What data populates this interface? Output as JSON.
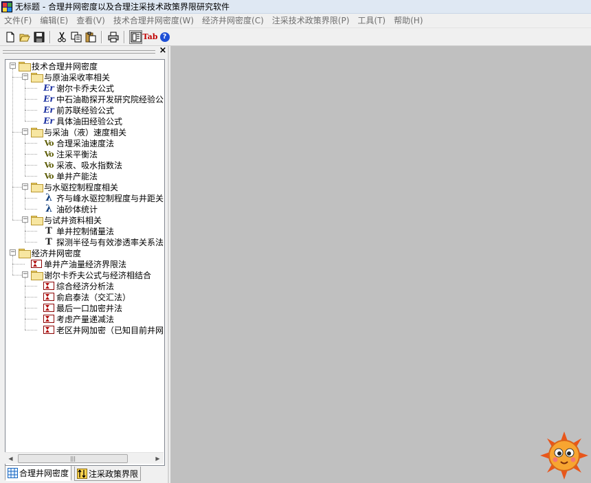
{
  "window": {
    "title": "无标题 - 合理井网密度以及合理注采技术政策界限研究软件"
  },
  "menu": [
    "文件(F)",
    "编辑(E)",
    "查看(V)",
    "技术合理井网密度(W)",
    "经济井网密度(C)",
    "注采技术政策界限(P)",
    "工具(T)",
    "帮助(H)"
  ],
  "toolbar": {
    "buttons": [
      "new-file-icon",
      "open-folder-icon",
      "save-disk-icon",
      "cut-scissors-icon",
      "copy-icon",
      "paste-icon",
      "print-icon",
      "tree-view-icon",
      "tab-icon",
      "help-icon"
    ],
    "tab_label": "Tab",
    "help_label": "?"
  },
  "tree": {
    "nodes": [
      {
        "label": "技术合理井网密度",
        "icon": "folder",
        "level": 0
      },
      {
        "label": "与原油采收率相关",
        "icon": "folder",
        "level": 1
      },
      {
        "label": "谢尔卡乔夫公式",
        "icon": "er",
        "level": 2
      },
      {
        "label": "中石油勘探开发研究院经验公",
        "icon": "er",
        "level": 2
      },
      {
        "label": "前苏联经验公式",
        "icon": "er",
        "level": 2
      },
      {
        "label": "具体油田经验公式",
        "icon": "er",
        "level": 2
      },
      {
        "label": "与采油（液）速度相关",
        "icon": "folder",
        "level": 1
      },
      {
        "label": "合理采油速度法",
        "icon": "vo",
        "level": 2
      },
      {
        "label": "注采平衡法",
        "icon": "vo",
        "level": 2
      },
      {
        "label": "采液、吸水指数法",
        "icon": "vo",
        "level": 2
      },
      {
        "label": "单井产能法",
        "icon": "vo",
        "level": 2
      },
      {
        "label": "与水驱控制程度相关",
        "icon": "folder",
        "level": 1
      },
      {
        "label": "齐与峰水驱控制程度与井距关",
        "icon": "lambda",
        "level": 2
      },
      {
        "label": "油砂体统计",
        "icon": "lambda",
        "level": 2
      },
      {
        "label": "与试井资料相关",
        "icon": "folder",
        "level": 1
      },
      {
        "label": "单井控制储量法",
        "icon": "t",
        "level": 2
      },
      {
        "label": "探测半径与有效渗透率关系法",
        "icon": "t",
        "level": 2
      },
      {
        "label": "经济井网密度",
        "icon": "folder",
        "level": 0
      },
      {
        "label": "单井产油量经济界限法",
        "icon": "hourglass",
        "level": 1
      },
      {
        "label": "谢尔卡乔夫公式与经济相结合",
        "icon": "folder",
        "level": 1
      },
      {
        "label": "综合经济分析法",
        "icon": "hourglass",
        "level": 2
      },
      {
        "label": "俞启泰法（交汇法）",
        "icon": "hourglass",
        "level": 2
      },
      {
        "label": "最后一口加密井法",
        "icon": "hourglass",
        "level": 2
      },
      {
        "label": "考虑产量递减法",
        "icon": "hourglass",
        "level": 2
      },
      {
        "label": "老区井网加密（已知目前井网",
        "icon": "hourglass",
        "level": 2
      }
    ],
    "er_text": "Er",
    "vo_text": "Vo",
    "lambda_text": "λ",
    "t_text": "T"
  },
  "scrollbar": {
    "thumb_grip": "|||"
  },
  "tabs": [
    {
      "label": "合理井网密度",
      "icon": "grid-icon",
      "active": true
    },
    {
      "label": "注采政策界限",
      "icon": "arrows-icon",
      "active": false
    }
  ],
  "colors": {
    "workspace": "#c0c0c0",
    "er_icon": "#1a2fa0",
    "vo_icon": "#5a5a00",
    "folder": "#f7e6a1"
  }
}
